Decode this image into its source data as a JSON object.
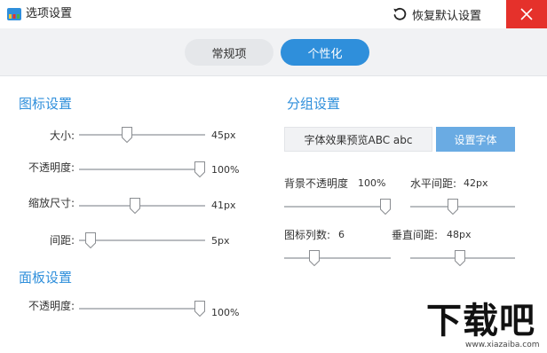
{
  "window": {
    "title": "选项设置",
    "restore_label": "恢复默认设置",
    "close_icon": "close-icon"
  },
  "tabs": [
    {
      "label": "常规项",
      "active": false
    },
    {
      "label": "个性化",
      "active": true
    }
  ],
  "icon_settings": {
    "title": "图标设置",
    "rows": [
      {
        "label": "大小:",
        "value": "45px",
        "fraction": 0.37
      },
      {
        "label": "不透明度:",
        "value": "100%",
        "fraction": 1.0
      },
      {
        "label": "缩放尺寸:",
        "value": "41px",
        "fraction": 0.44
      },
      {
        "label": "间距:",
        "value": "5px",
        "fraction": 0.05
      }
    ]
  },
  "panel_settings": {
    "title": "面板设置",
    "rows": [
      {
        "label": "不透明度:",
        "value": "100%",
        "fraction": 1.0
      }
    ]
  },
  "group_settings": {
    "title": "分组设置",
    "preview_text": "字体效果预览ABC abc",
    "set_font_label": "设置字体",
    "bg_opacity": {
      "label": "背景不透明度",
      "value": "100%",
      "fraction": 1.0
    },
    "h_spacing": {
      "label": "水平间距:",
      "value": "42px",
      "fraction": 0.4
    },
    "icon_columns": {
      "label": "图标列数:",
      "value": "6",
      "fraction": 0.26
    },
    "v_spacing": {
      "label": "垂直间距:",
      "value": "48px",
      "fraction": 0.47
    }
  },
  "watermark": {
    "logo_text": "下载吧",
    "url": "www.xiazaiba.com"
  },
  "colors": {
    "accent": "#2f8fdb",
    "close_bg": "#e5312b",
    "font_button": "#6aabe3"
  }
}
